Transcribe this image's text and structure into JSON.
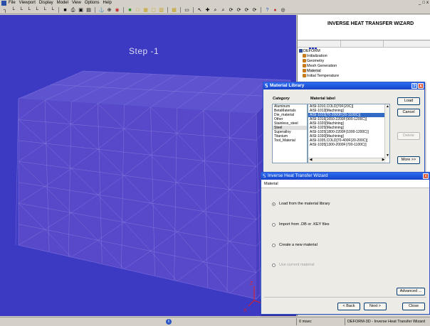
{
  "menubar": {
    "items": [
      "File",
      "Viewport",
      "Display",
      "Model",
      "View",
      "Options",
      "Help"
    ],
    "window_controls": [
      "_",
      "ȡ",
      "x"
    ]
  },
  "toolbar": {
    "icons": [
      "view-xy-icon",
      "view-yz-icon",
      "view-zx-icon",
      "view-iso1-icon",
      "view-iso2-icon",
      "view-iso3-icon",
      "view-iso4-icon",
      "save-icon",
      "print-icon",
      "copy-image-icon",
      "copy-window-icon",
      "measure-icon",
      "axis-icon",
      "rotate-icon",
      "shade-icon",
      "wire-icon",
      "mesh-icon",
      "outline-icon",
      "edge-icon",
      "grid-icon",
      "pointer-icon",
      "pan-icon",
      "zoom-icon",
      "zoom-box-icon",
      "rotate-x-icon",
      "rotate-y-icon",
      "rotate-z-icon",
      "rotate-free-icon",
      "help-icon",
      "record-icon",
      "target-icon"
    ]
  },
  "viewport": {
    "step_label": "Step   -1",
    "axis_z": "Z",
    "axis_x": "X",
    "background_color": "#3c39c3",
    "mesh_color": "#7b6cd8"
  },
  "wizard_panel": {
    "title": "INVERSE HEAT TRANSFER WIZARD",
    "progress_percent": 17,
    "tree": [
      {
        "label": "DEFORM",
        "level": 0,
        "selected": false
      },
      {
        "label": "Initialization",
        "level": 1,
        "selected": false
      },
      {
        "label": "Geometry",
        "level": 1,
        "selected": false
      },
      {
        "label": "Mesh Generation",
        "level": 1,
        "selected": false
      },
      {
        "label": "Material",
        "level": 1,
        "selected": true
      },
      {
        "label": "Initial Temperature",
        "level": 1,
        "selected": false
      }
    ]
  },
  "material_library": {
    "title": "Material Library",
    "category_label": "Category",
    "material_label": "Material label",
    "categories": [
      "Aluminum",
      "BetaMaterials",
      "Die_material",
      "Other",
      "Stainless_steel",
      "Steel",
      "Superalloy",
      "Titanium",
      "Tool_Material"
    ],
    "selected_category": "Steel",
    "materials": [
      "AISI-1010,COLD[70F(20C)]",
      "AISI-1013[Machining]",
      "AISI-1015[70-2000F(20-1100C)]",
      "AISI-1016[1650-2200F(900-1200C)]",
      "AISI-1020[Machining]",
      "AISI-1025[Machining]",
      "AISI-1025[1800-2200F(1000-1200C)]",
      "AISI-1030[Machining]",
      "AISI-1035,COLD[70-400F(20-200C)]",
      "AISI-1035[1300-2000F(700-1100C)]"
    ],
    "selected_material": "AISI-1015[70-2000F(20-1100C)]",
    "buttons": {
      "load": "Load",
      "cancel": "Cancel",
      "delete": "Delete",
      "more": "More >>"
    },
    "help_btn": "?",
    "close_btn": "X"
  },
  "ihtw_dialog": {
    "title": "Inverse Heat Transfer Wizard",
    "section": "Material",
    "options": [
      {
        "label": "Load from the material library",
        "selected": true,
        "enabled": true
      },
      {
        "label": "Import from .DB or .KEY files",
        "selected": false,
        "enabled": true
      },
      {
        "label": "Create a new material",
        "selected": false,
        "enabled": true
      },
      {
        "label": "Use current material",
        "selected": false,
        "enabled": false
      }
    ],
    "buttons": {
      "advanced": "Advanced ...",
      "back": "< Back",
      "next": "Next >",
      "close": "Close"
    },
    "close_btn": "X"
  },
  "statusbar": {
    "info": "i",
    "time": "0 msec",
    "app": "DEFORM-3D  -  Inverse Heat Transfer Wizard"
  }
}
